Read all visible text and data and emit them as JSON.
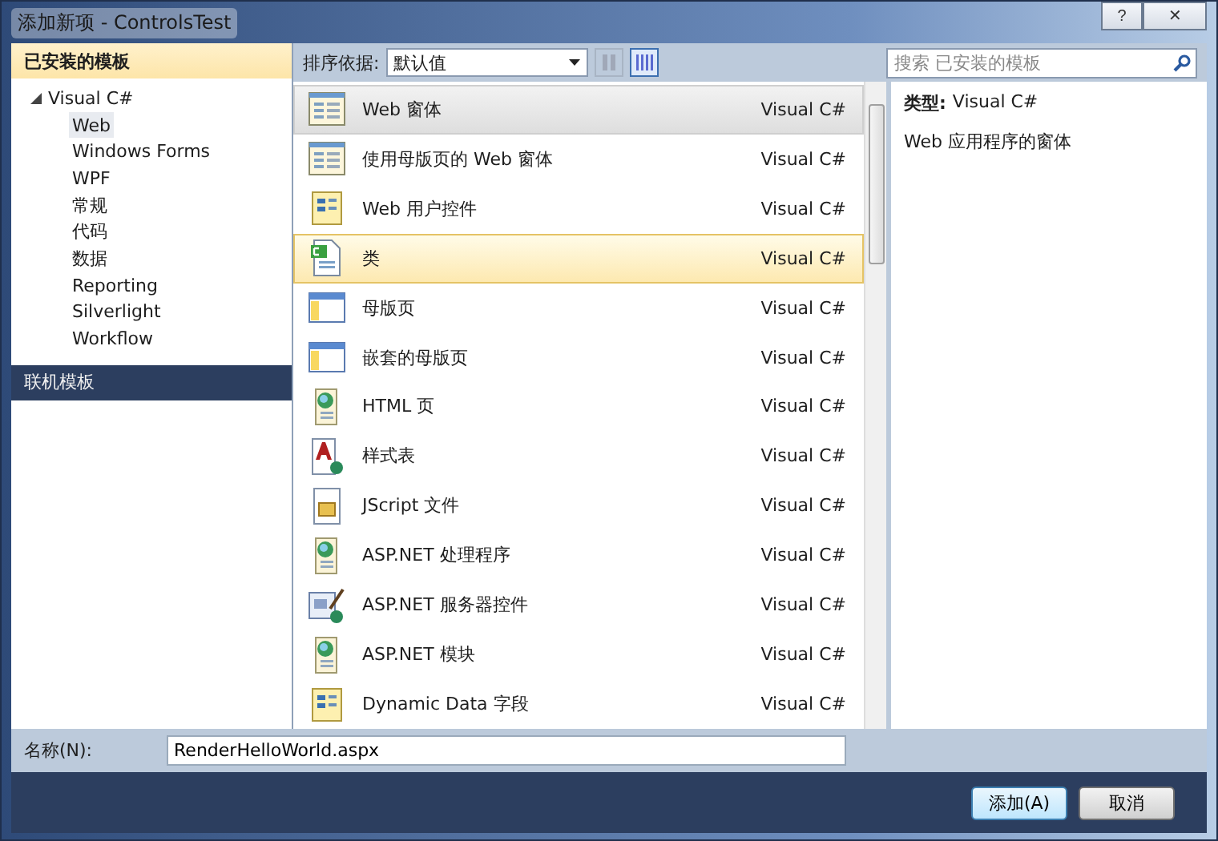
{
  "window": {
    "title": "添加新项 - ControlsTest",
    "help": "?",
    "close": "✕"
  },
  "sidebar": {
    "sections": [
      {
        "label": "已安装的模板",
        "selected": true,
        "tree": [
          {
            "label": "Visual C#",
            "expanded": true,
            "children": [
              {
                "label": "Web",
                "selected": true
              },
              {
                "label": "Windows Forms",
                "selected": false
              },
              {
                "label": "WPF",
                "selected": false
              },
              {
                "label": "常规",
                "selected": false
              },
              {
                "label": "代码",
                "selected": false
              },
              {
                "label": "数据",
                "selected": false
              },
              {
                "label": "Reporting",
                "selected": false
              },
              {
                "label": "Silverlight",
                "selected": false
              },
              {
                "label": "Workflow",
                "selected": false
              }
            ]
          }
        ]
      },
      {
        "label": "联机模板",
        "selected": false
      }
    ]
  },
  "toolbar": {
    "sort_label": "排序依据:",
    "sort_value": "默认值",
    "views": [
      {
        "kind": "small",
        "selected": false
      },
      {
        "kind": "large",
        "selected": true
      }
    ],
    "search": {
      "placeholder": "搜索 已安装的模板"
    }
  },
  "items": [
    {
      "kind": "form",
      "name": "Web 窗体",
      "type": "Visual C#",
      "hovered": true,
      "selected": false
    },
    {
      "kind": "form",
      "name": "使用母版页的 Web 窗体",
      "type": "Visual C#",
      "hovered": false,
      "selected": false
    },
    {
      "kind": "usercontrol",
      "name": "Web 用户控件",
      "type": "Visual C#",
      "hovered": false,
      "selected": false
    },
    {
      "kind": "class",
      "name": "类",
      "type": "Visual C#",
      "hovered": false,
      "selected": true
    },
    {
      "kind": "master",
      "name": "母版页",
      "type": "Visual C#",
      "hovered": false,
      "selected": false
    },
    {
      "kind": "master",
      "name": "嵌套的母版页",
      "type": "Visual C#",
      "hovered": false,
      "selected": false
    },
    {
      "kind": "globe",
      "name": "HTML 页",
      "type": "Visual C#",
      "hovered": false,
      "selected": false
    },
    {
      "kind": "style",
      "name": "样式表",
      "type": "Visual C#",
      "hovered": false,
      "selected": false
    },
    {
      "kind": "script",
      "name": "JScript 文件",
      "type": "Visual C#",
      "hovered": false,
      "selected": false
    },
    {
      "kind": "globe",
      "name": "ASP.NET 处理程序",
      "type": "Visual C#",
      "hovered": false,
      "selected": false
    },
    {
      "kind": "server",
      "name": "ASP.NET 服务器控件",
      "type": "Visual C#",
      "hovered": false,
      "selected": false
    },
    {
      "kind": "globe",
      "name": "ASP.NET 模块",
      "type": "Visual C#",
      "hovered": false,
      "selected": false
    },
    {
      "kind": "usercontrol",
      "name": "Dynamic Data 字段",
      "type": "Visual C#",
      "hovered": false,
      "selected": false
    }
  ],
  "details": {
    "type_label": "类型:",
    "type_value": "Visual C#",
    "description": "Web 应用程序的窗体"
  },
  "name_field": {
    "label": "名称(N):",
    "value": "RenderHelloWorld.aspx"
  },
  "buttons": [
    {
      "label": "添加(A)",
      "default": true
    },
    {
      "label": "取消",
      "default": false
    }
  ]
}
